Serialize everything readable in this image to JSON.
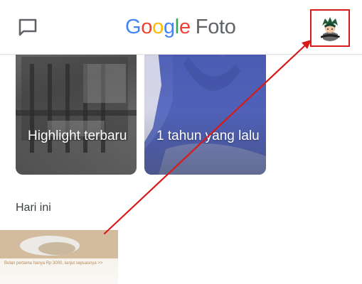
{
  "header": {
    "logo_letters": [
      "G",
      "o",
      "o",
      "g",
      "l",
      "e"
    ],
    "logo_colors": [
      "#4285F4",
      "#EA4335",
      "#FBBC05",
      "#4285F4",
      "#34A853",
      "#EA4335"
    ],
    "logo_suffix": "Foto",
    "left_icon": "message-square-icon",
    "right_control": "account-avatar"
  },
  "memories": [
    {
      "label": "Highlight terbaru"
    },
    {
      "label": "1 tahun yang lalu"
    }
  ],
  "section": {
    "title": "Hari ini"
  },
  "photo_caption": "Bulan pertama hanya Rp 3000, lanjut sepuasnya >>",
  "annotation": {
    "color": "#d71a1a"
  }
}
